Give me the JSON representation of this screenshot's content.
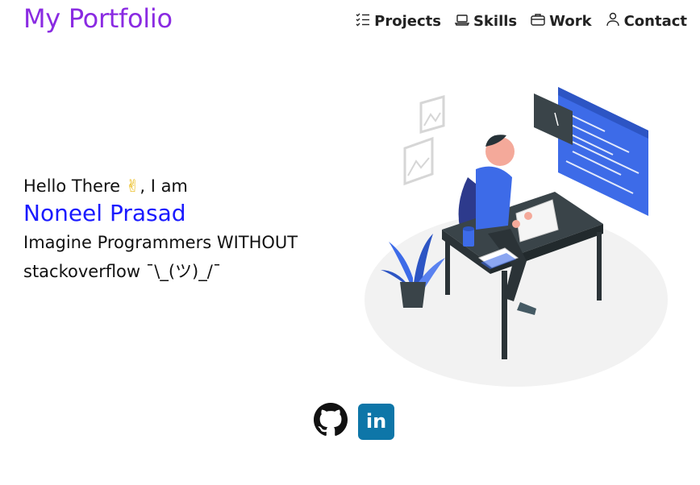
{
  "header": {
    "brand": "My Portfolio",
    "nav": [
      {
        "label": "Projects",
        "icon": "checklist-icon"
      },
      {
        "label": "Skills",
        "icon": "laptop-icon"
      },
      {
        "label": "Work",
        "icon": "briefcase-icon"
      },
      {
        "label": "Contact",
        "icon": "person-icon"
      }
    ]
  },
  "hero": {
    "greeting_prefix": "Hello There ",
    "greeting_emoji": "✌",
    "greeting_suffix": ", I am",
    "name": "Noneel Prasad",
    "tagline": "Imagine Programmers WITHOUT stackoverflow ¯\\_(ツ)_/¯"
  },
  "social": {
    "github_icon": "github-icon",
    "linkedin_icon": "linkedin-icon",
    "linkedin_text": "in"
  },
  "colors": {
    "brand": "#8a2be2",
    "name": "#1a1aff",
    "accent": "#3d6be8",
    "linkedin": "#0e76a8"
  }
}
